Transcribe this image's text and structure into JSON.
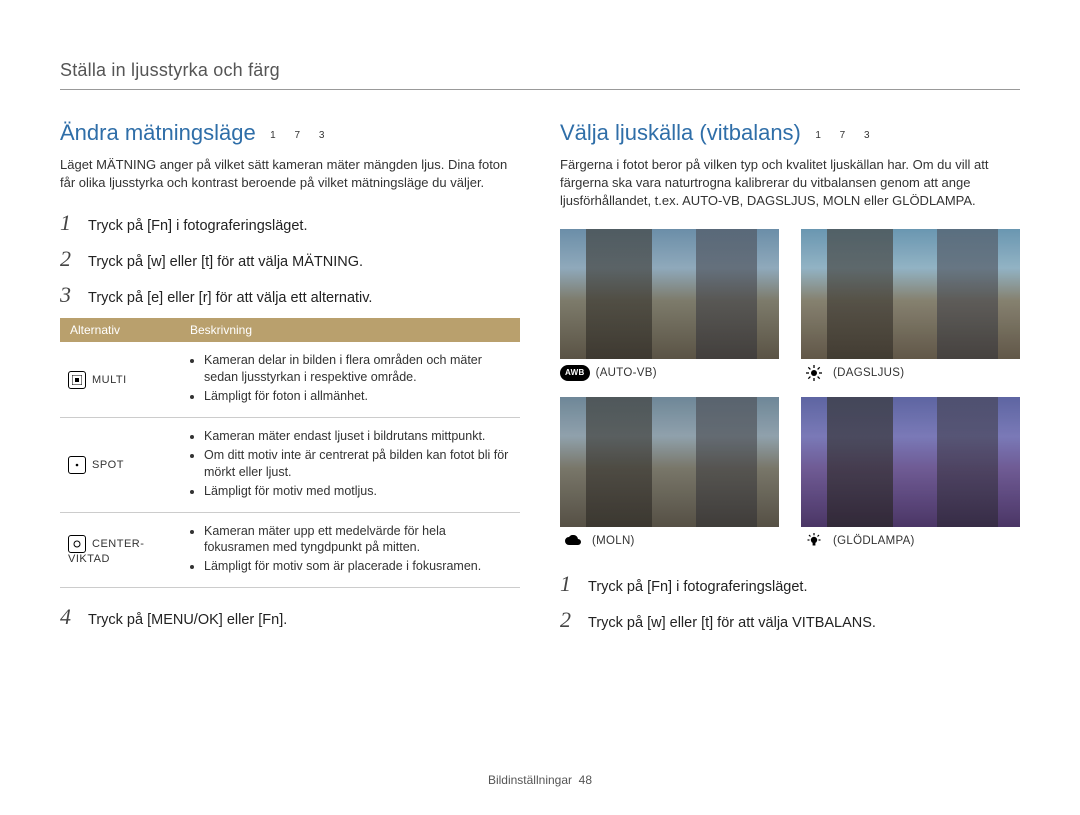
{
  "header": "Ställa in ljusstyrka och färg",
  "left": {
    "title": "Ändra mätningsläge",
    "title_icons": "1  7     3",
    "intro": "Läget MÄTNING anger på vilket sätt kameran mäter mängden ljus. Dina foton får olika ljusstyrka och kontrast beroende på vilket mätningsläge du väljer.",
    "steps": {
      "s1": "Tryck på [Fn] i fotograferingsläget.",
      "s2": "Tryck på [w] eller [t] för att välja MÄTNING.",
      "s3": "Tryck på [e] eller [r] för att välja ett alternativ.",
      "s4": "Tryck på [MENU/OK] eller [Fn]."
    },
    "table": {
      "head_alt": "Alternativ",
      "head_desc": "Beskrivning",
      "rows": [
        {
          "name": "MULTI",
          "bullets": [
            "Kameran delar in bilden i flera områden och mäter sedan ljusstyrkan i respektive område.",
            "Lämpligt för foton i allmänhet."
          ]
        },
        {
          "name": "SPOT",
          "bullets": [
            "Kameran mäter endast ljuset i bildrutans mittpunkt.",
            "Om ditt motiv inte är centrerat på bilden kan fotot bli för mörkt eller ljust.",
            "Lämpligt för motiv med motljus."
          ]
        },
        {
          "name": "CENTER-VIKTAD",
          "bullets": [
            "Kameran mäter upp ett medelvärde för hela fokusramen med tyngdpunkt på mitten.",
            "Lämpligt för motiv som är placerade i fokusramen."
          ]
        }
      ]
    }
  },
  "right": {
    "title": "Välja ljuskälla (vitbalans)",
    "title_icons": "1  7     3",
    "intro": "Färgerna i fotot beror på vilken typ och kvalitet ljuskällan har. Om du vill att färgerna ska vara naturtrogna kalibrerar du vitbalansen genom att ange ljusförhållandet, t.ex. AUTO-VB, DAGSLJUS, MOLN eller GLÖDLAMPA.",
    "thumbs": {
      "t1": "(AUTO-VB)",
      "t2": "(DAGSLJUS)",
      "t3": "(MOLN)",
      "t4": "(GLÖDLAMPA)"
    },
    "steps": {
      "s1": "Tryck på [Fn] i fotograferingsläget.",
      "s2": "Tryck på [w] eller [t] för att välja VITBALANS."
    }
  },
  "footer": {
    "section": "Bildinställningar",
    "page": "48"
  }
}
